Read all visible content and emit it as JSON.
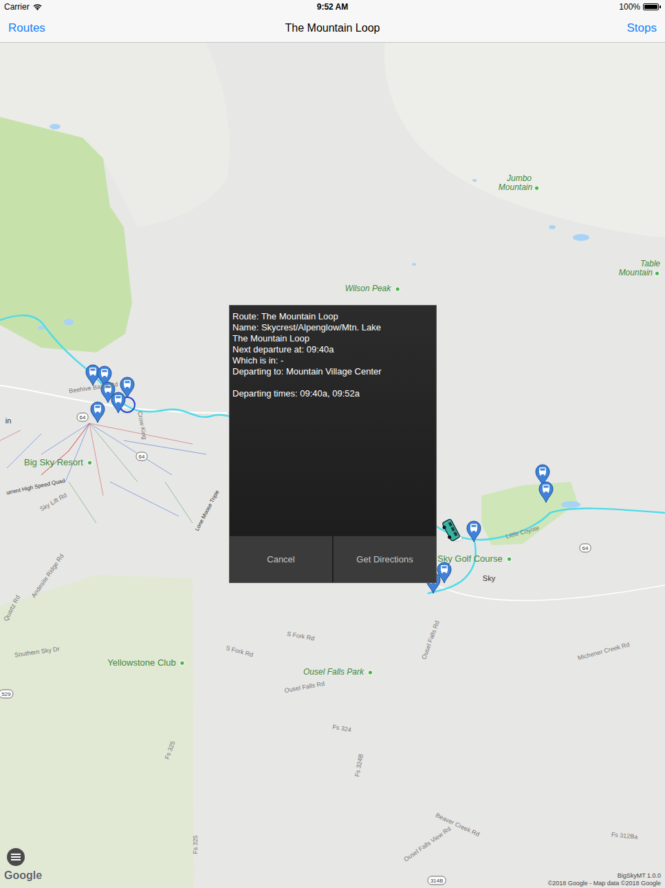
{
  "status_bar": {
    "carrier": "Carrier",
    "time": "9:52 AM",
    "battery": "100%",
    "battery_level": 1
  },
  "nav": {
    "back": "Routes",
    "title": "The Mountain Loop",
    "action": "Stops"
  },
  "map": {
    "labels": [
      {
        "text": "Jumbo Mountain",
        "kind": "peak"
      },
      {
        "text": "Table Mountain",
        "kind": "peak"
      },
      {
        "text": "Wilson Peak",
        "kind": "peak"
      },
      {
        "text": "Big Sky Resort",
        "kind": "place"
      },
      {
        "text": "Yellowstone Club",
        "kind": "place"
      },
      {
        "text": "Ousel Falls Park",
        "kind": "peak"
      },
      {
        "text": "Sky Golf Course",
        "kind": "place"
      },
      {
        "text": "Sky",
        "kind": "town"
      },
      {
        "text": "in",
        "kind": "town"
      },
      {
        "text": "Beehive Basin Rd",
        "kind": "road"
      },
      {
        "text": "Lone Moose Triple",
        "kind": "lift"
      },
      {
        "text": "urrent High Speed Quad",
        "kind": "lift"
      },
      {
        "text": "Sky Lift Rd",
        "kind": "road"
      },
      {
        "text": "Andesite Ridge Rd",
        "kind": "road"
      },
      {
        "text": "Quartz Rd",
        "kind": "road"
      },
      {
        "text": "Southern Sky Dr",
        "kind": "road"
      },
      {
        "text": "S Fork Rd",
        "kind": "road"
      },
      {
        "text": "S Fork Rd",
        "kind": "road"
      },
      {
        "text": "Ousel Falls Rd",
        "kind": "road"
      },
      {
        "text": "Fs 324",
        "kind": "road"
      },
      {
        "text": "Fs 324B",
        "kind": "road"
      },
      {
        "text": "Fs 325",
        "kind": "road"
      },
      {
        "text": "Fs 325",
        "kind": "road"
      },
      {
        "text": "Beaver Creek Rd",
        "kind": "road"
      },
      {
        "text": "Ousel Falls View Rd",
        "kind": "road"
      },
      {
        "text": "Fs 312Ba",
        "kind": "road"
      },
      {
        "text": "Michener Creek Rd",
        "kind": "road"
      },
      {
        "text": "Little Coyote",
        "kind": "road"
      },
      {
        "text": "Crow King",
        "kind": "road"
      },
      {
        "text": "Ousel Falls Rd",
        "kind": "road"
      }
    ],
    "shields": [
      {
        "text": "64"
      },
      {
        "text": "64"
      },
      {
        "text": "64"
      },
      {
        "text": "529"
      },
      {
        "text": "314B"
      }
    ],
    "logo": "Google",
    "attribution": "©2018 Google - Map data ©2018 Google",
    "version": "BigSkyMT 1.0.0"
  },
  "popup": {
    "lines": [
      "Route: The Mountain Loop",
      "Name: Skycrest/Alpenglow/Mtn. Lake",
      "The Mountain Loop",
      "Next departure at: 09:40a",
      "Which is in: -",
      "Departing to: Mountain Village Center"
    ],
    "departing_times": "Departing times: 09:40a, 09:52a",
    "buttons": [
      {
        "label": "Cancel"
      },
      {
        "label": "Get Directions"
      }
    ]
  }
}
